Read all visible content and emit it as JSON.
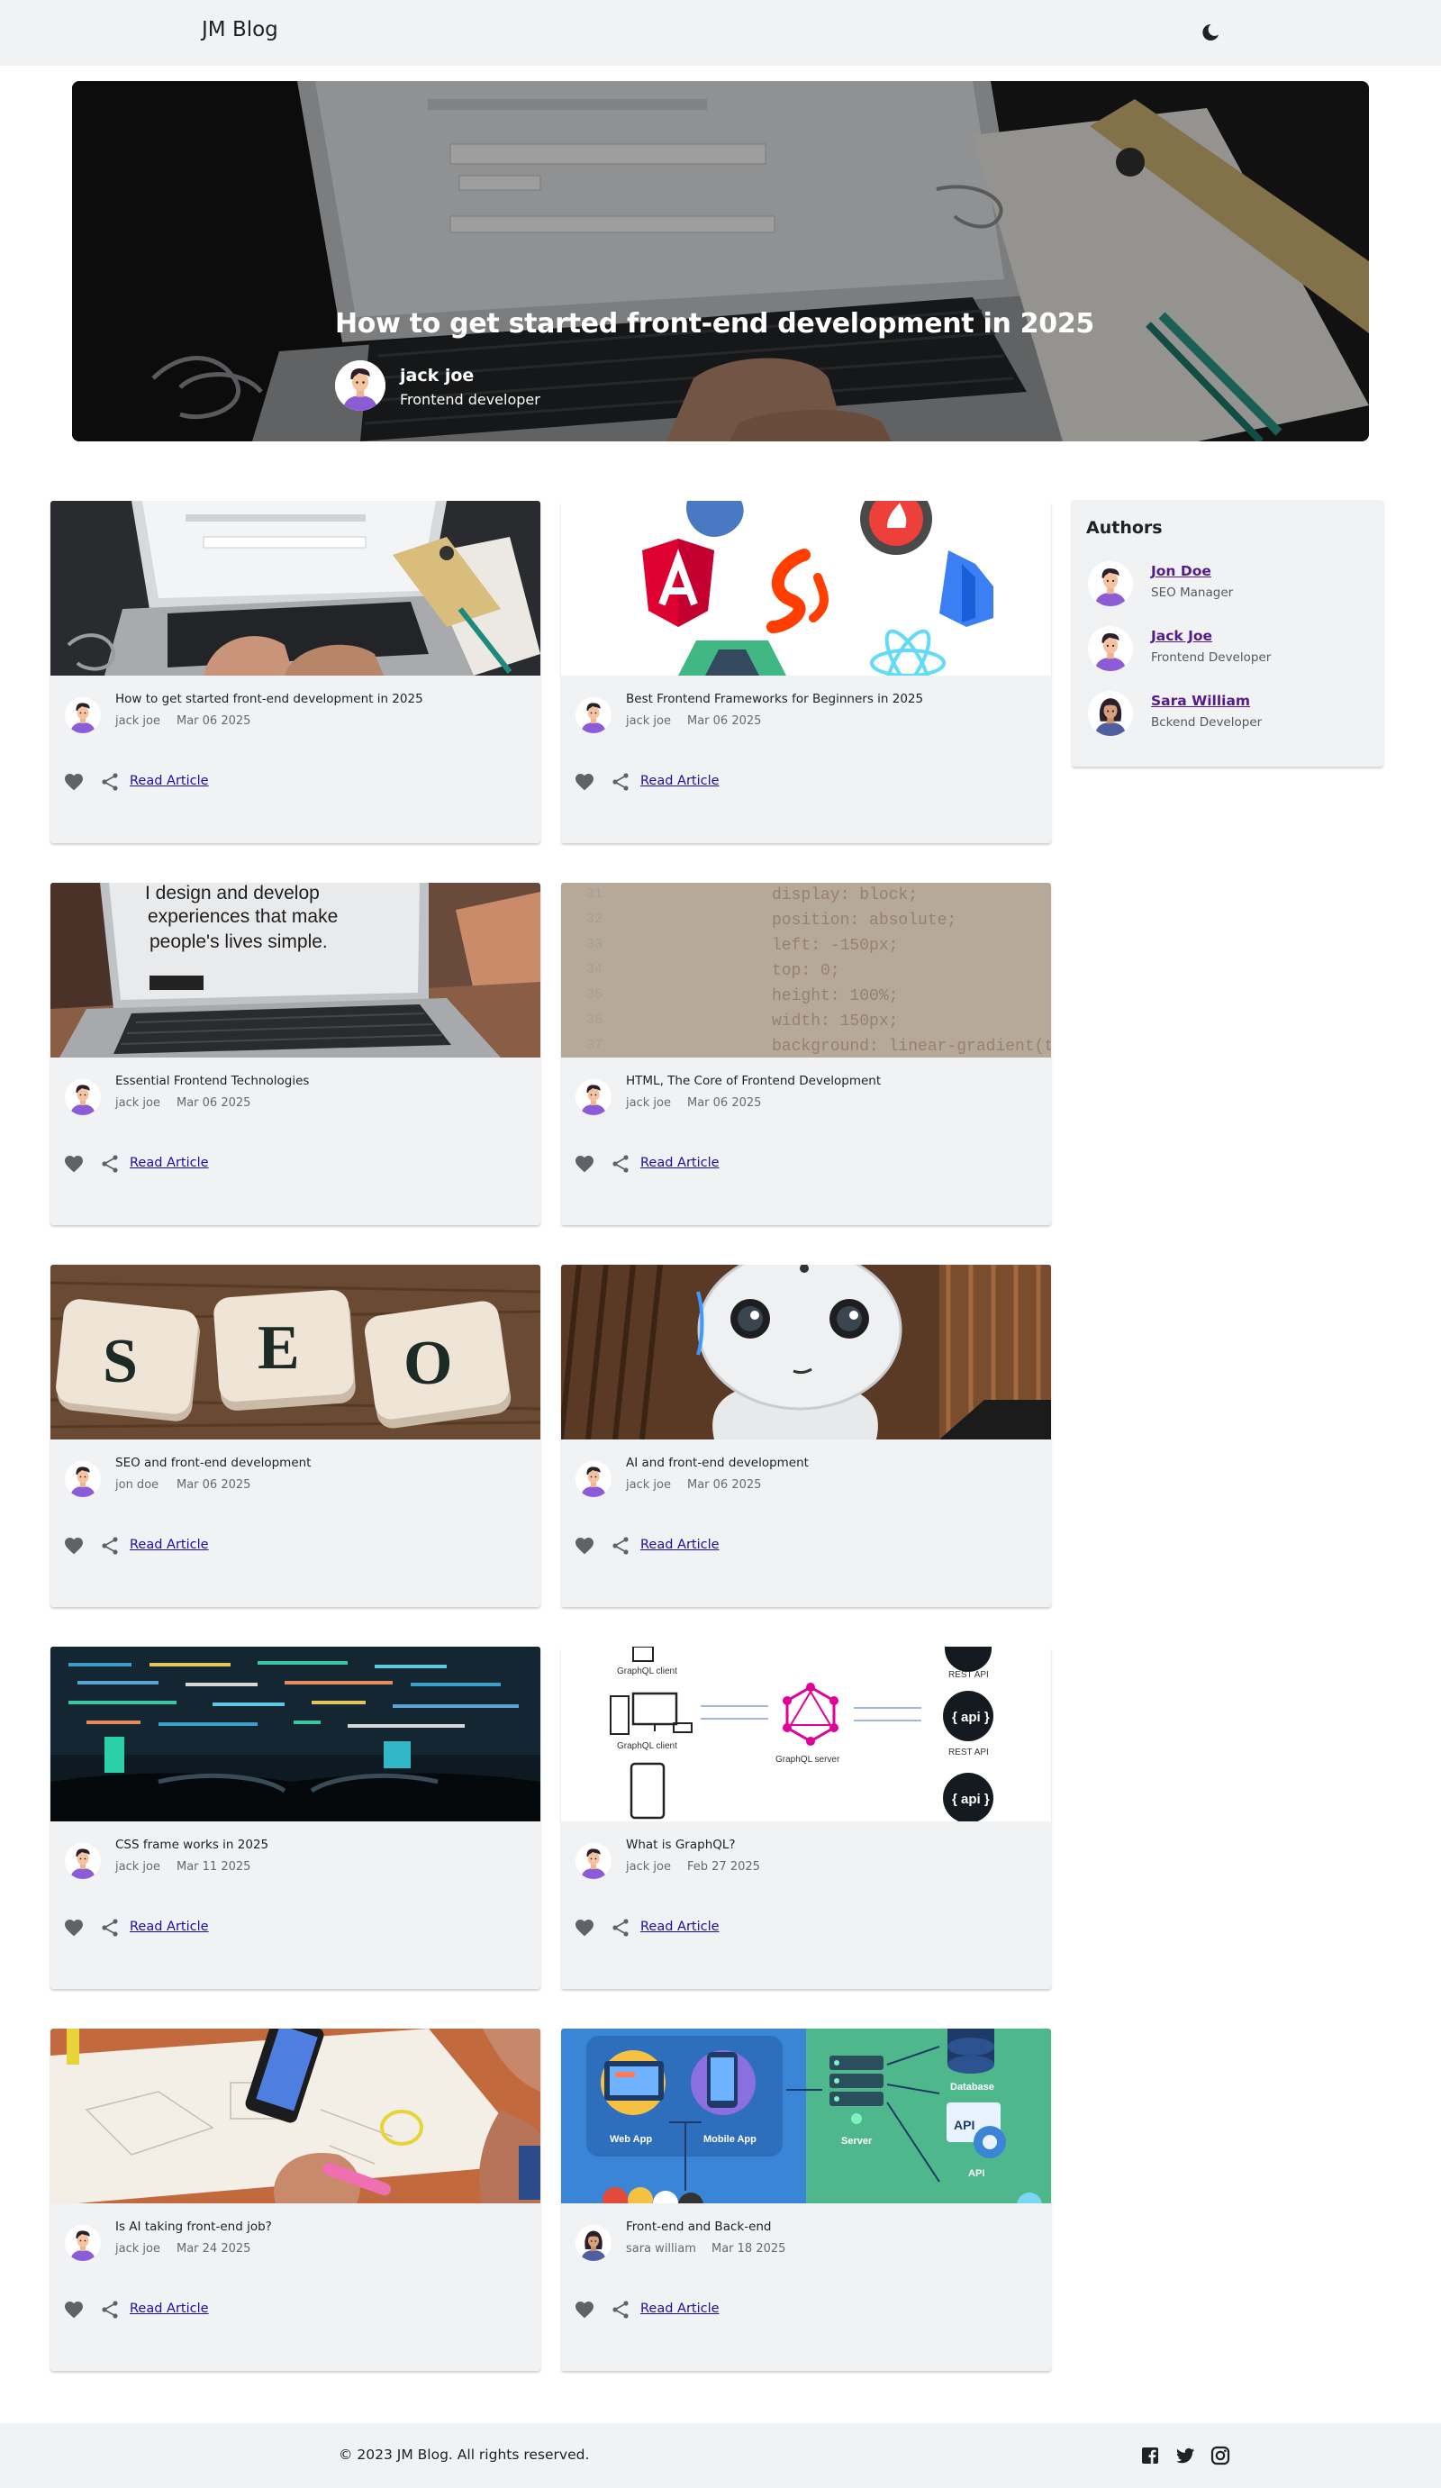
{
  "header": {
    "brand": "JM Blog",
    "theme_toggle_icon": "moon-icon"
  },
  "hero": {
    "title": "How to get started front-end development in 2025",
    "author": "jack joe",
    "role": "Frontend developer"
  },
  "cards": [
    {
      "title": "How to get started front-end development in 2025",
      "author": "jack joe",
      "date": "Mar 06 2025",
      "link": "Read Article"
    },
    {
      "title": "Best Frontend Frameworks for Beginners in 2025",
      "author": "jack joe",
      "date": "Mar 06 2025",
      "link": "Read Article"
    },
    {
      "title": "Essential Frontend Technologies",
      "author": "jack joe",
      "date": "Mar 06 2025",
      "link": "Read Article"
    },
    {
      "title": "HTML, The Core of Frontend Development",
      "author": "jack joe",
      "date": "Mar 06 2025",
      "link": "Read Article"
    },
    {
      "title": "SEO and front-end development",
      "author": "jon doe",
      "date": "Mar 06 2025",
      "link": "Read Article"
    },
    {
      "title": "AI and front-end development",
      "author": "jack joe",
      "date": "Mar 06 2025",
      "link": "Read Article"
    },
    {
      "title": "CSS frame works in 2025",
      "author": "jack joe",
      "date": "Mar 11 2025",
      "link": "Read Article"
    },
    {
      "title": "What is GraphQL?",
      "author": "jack joe",
      "date": "Feb 27 2025",
      "link": "Read Article"
    },
    {
      "title": "Is AI taking front-end job?",
      "author": "jack joe",
      "date": "Mar 24 2025",
      "link": "Read Article"
    },
    {
      "title": "Front-end and Back-end",
      "author": "sara william",
      "date": "Mar 18 2025",
      "link": "Read Article"
    }
  ],
  "image_text": {
    "design": [
      "I design and develop",
      "experiences that make",
      "people's lives simple."
    ],
    "css": [
      "display: block;",
      "position: absolute;",
      "left: -150px;",
      "top: 0;",
      "height: 100%;",
      "width: 150px;",
      "background: linear-gradient(to"
    ],
    "seo": [
      "S",
      "E",
      "O"
    ],
    "graphql": [
      "GraphQL client",
      "GraphQL client",
      "GraphQL server",
      "REST API",
      "REST API",
      "{ api }",
      "{ api }"
    ],
    "frontback": [
      "Web App",
      "Mobile App",
      "Server",
      "Database",
      "API",
      "API"
    ]
  },
  "authors": {
    "title": "Authors",
    "items": [
      {
        "name": "Jon Doe",
        "role": "SEO Manager"
      },
      {
        "name": "Jack Joe",
        "role": "Frontend Developer"
      },
      {
        "name": "Sara William",
        "role": "Bckend Developer"
      }
    ]
  },
  "footer": {
    "copyright": "© 2023 JM Blog. All rights reserved.",
    "social": [
      "facebook-icon",
      "twitter-icon",
      "instagram-icon"
    ]
  },
  "colors": {
    "background": "#ffffff",
    "panel": "#f1f2f4",
    "link": "#1a0dab",
    "visited_link": "#551a8b",
    "avatar_shirt": "#8c5bd6"
  }
}
